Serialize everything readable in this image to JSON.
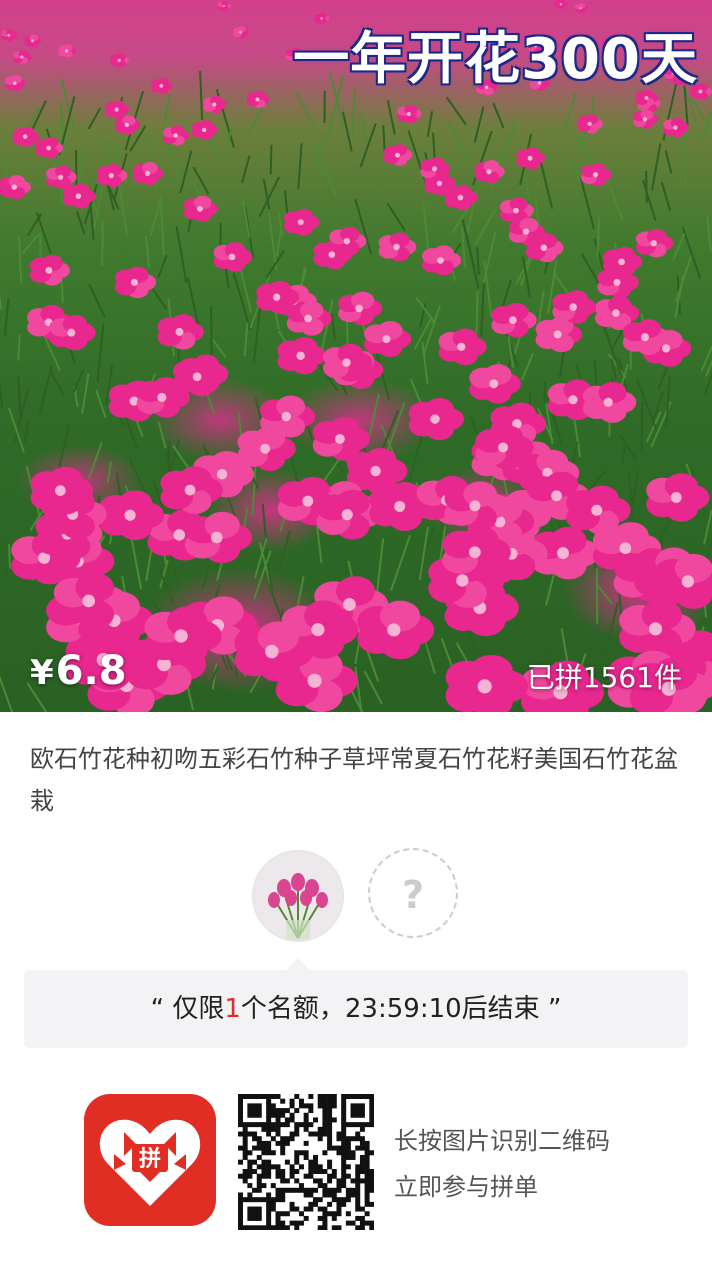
{
  "banner": {
    "title": "一年开花300天",
    "price_symbol": "¥",
    "price": "6.8",
    "sold": "已拼1561件"
  },
  "product": {
    "name": "欧石竹花种初吻五彩石竹种子草坪常夏石竹花籽美国石竹花盆栽"
  },
  "group": {
    "avatar_icon": "user-avatar",
    "placeholder_icon": "question-mark-icon",
    "placeholder": "?"
  },
  "notice": {
    "open_quote": "“",
    "prefix": "仅限",
    "count": "1",
    "suffix": "个名额，23:59:10后结束",
    "close_quote": "”",
    "highlight_color": "#e02e24"
  },
  "footer": {
    "app_icon": "pinduoduo-logo-icon",
    "app_text": "拼",
    "qr_icon": "qr-code",
    "line1": "长按图片识别二维码",
    "line2": "立即参与拼单"
  },
  "colors": {
    "brand": "#e02e24"
  }
}
